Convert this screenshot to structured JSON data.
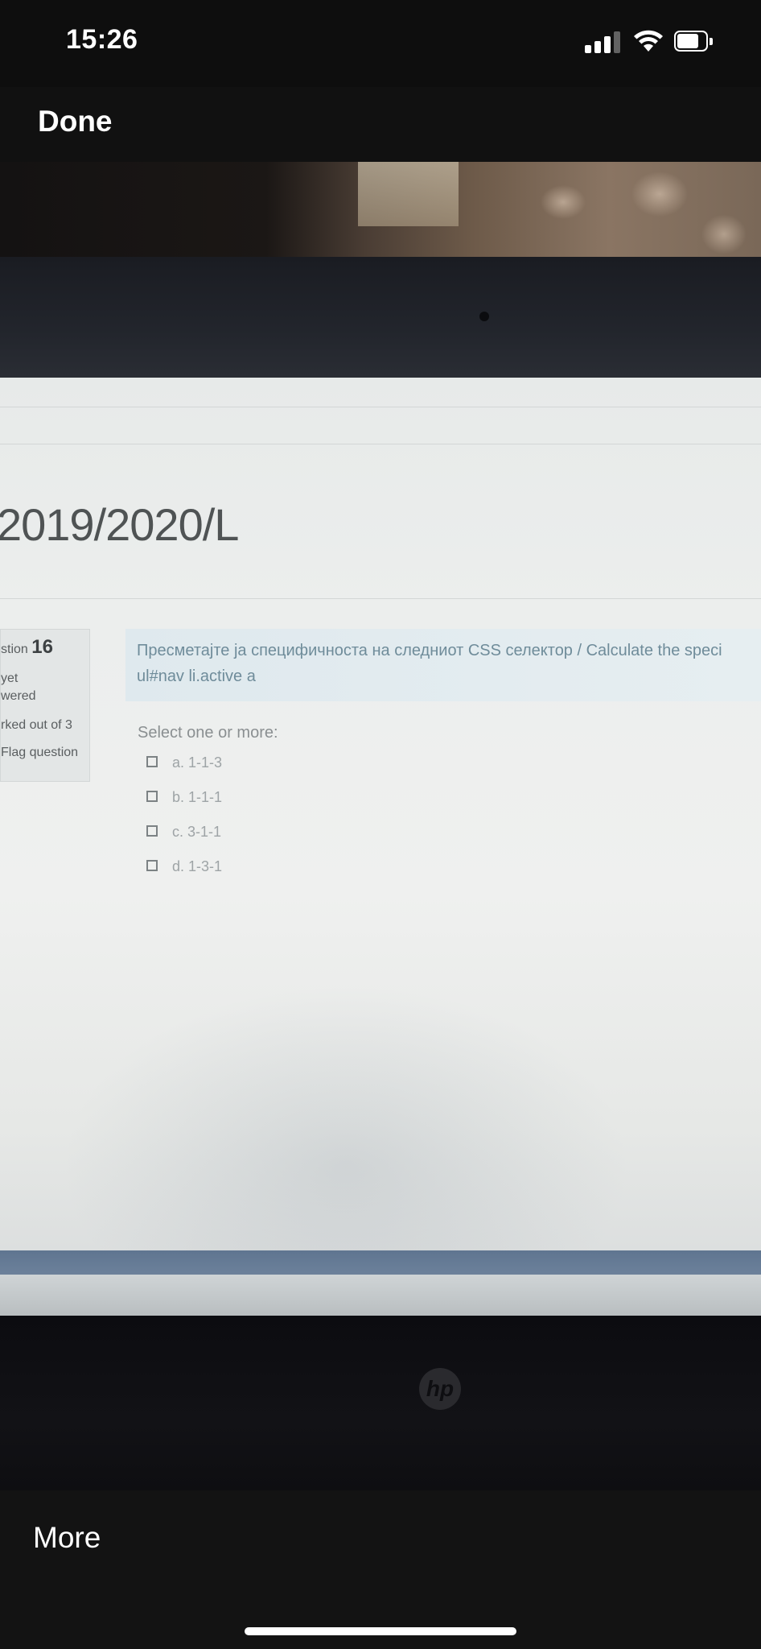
{
  "status_bar": {
    "time": "15:26",
    "signal_icon": "cellular-signal-icon",
    "wifi_icon": "wifi-icon",
    "battery_icon": "battery-icon"
  },
  "nav": {
    "done_label": "Done"
  },
  "photo": {
    "course_title": "2019/2020/L",
    "info": {
      "question_prefix": "stion",
      "question_number": "16",
      "status_line1": "yet",
      "status_line2": "wered",
      "marks": "rked out of 3",
      "flag_label": "Flag question"
    },
    "question": {
      "text_line1": "Пресметајте ја специфичноста на следниот CSS селектор / Calculate the speci",
      "text_line2": "ul#nav li.active a",
      "select_label": "Select one or more:",
      "options": [
        {
          "label": "a. 1-1-3"
        },
        {
          "label": "b. 1-1-1"
        },
        {
          "label": "c. 3-1-1"
        },
        {
          "label": "d. 1-3-1"
        }
      ]
    },
    "laptop_logo": "hp"
  },
  "toolbar": {
    "more_label": "More"
  },
  "colors": {
    "ios_bar": "#0e0e0e",
    "screen_bg": "#eceeed",
    "question_bg": "#dfe9ee",
    "question_text": "#6f8c9a",
    "footer_strip": "#5f7590"
  }
}
